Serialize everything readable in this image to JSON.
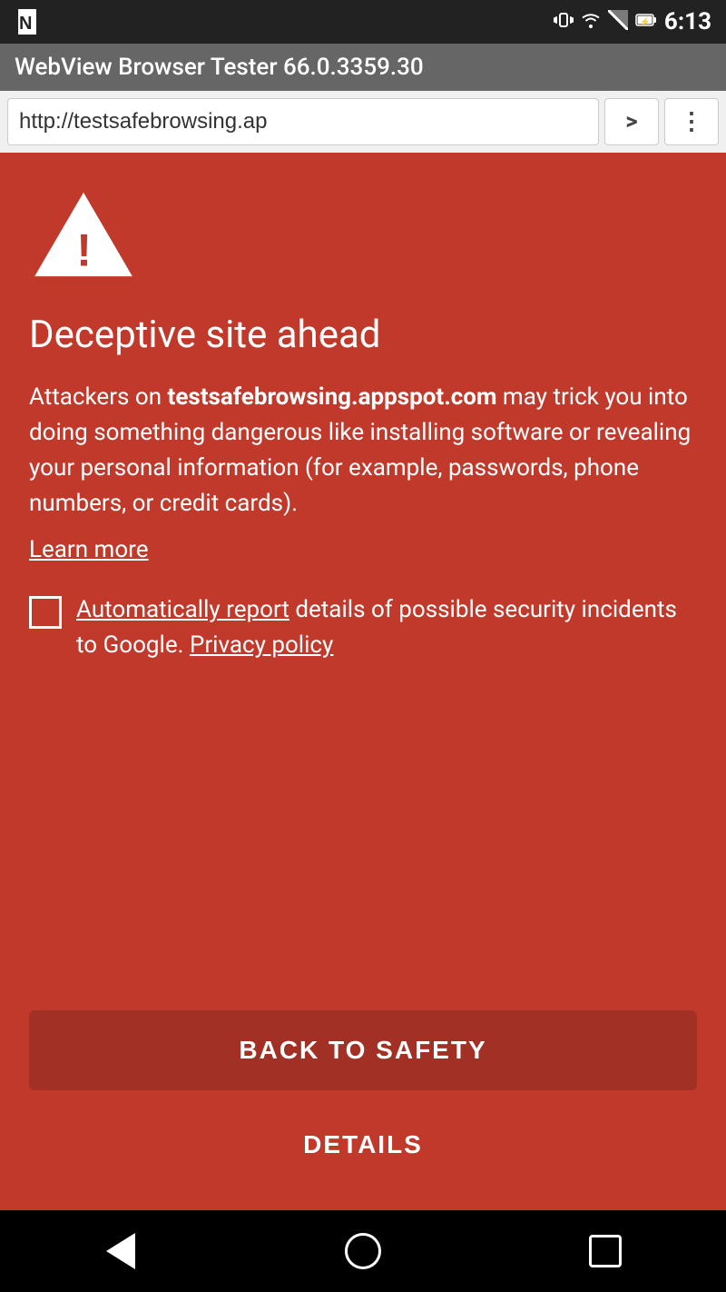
{
  "status_bar": {
    "time": "6:13",
    "n_logo": "N"
  },
  "browser": {
    "title": "WebView Browser Tester 66.0.3359.30",
    "url": "http://testsafebrowsing.ap",
    "forward_button": ">",
    "menu_button": "⋮"
  },
  "warning": {
    "title": "Deceptive site ahead",
    "body_prefix": "Attackers on ",
    "site_name": "testsafebrowsing.appspot.com",
    "body_suffix": " may trick you into doing something dangerous like installing software or revealing your personal information (for example, passwords, phone numbers, or credit cards).",
    "learn_more": "Learn more",
    "checkbox_label_linked": "Automatically report",
    "checkbox_label_rest": " details of possible security incidents to Google. ",
    "privacy_policy": "Privacy policy",
    "back_to_safety": "BACK TO SAFETY",
    "details": "DETAILS"
  }
}
